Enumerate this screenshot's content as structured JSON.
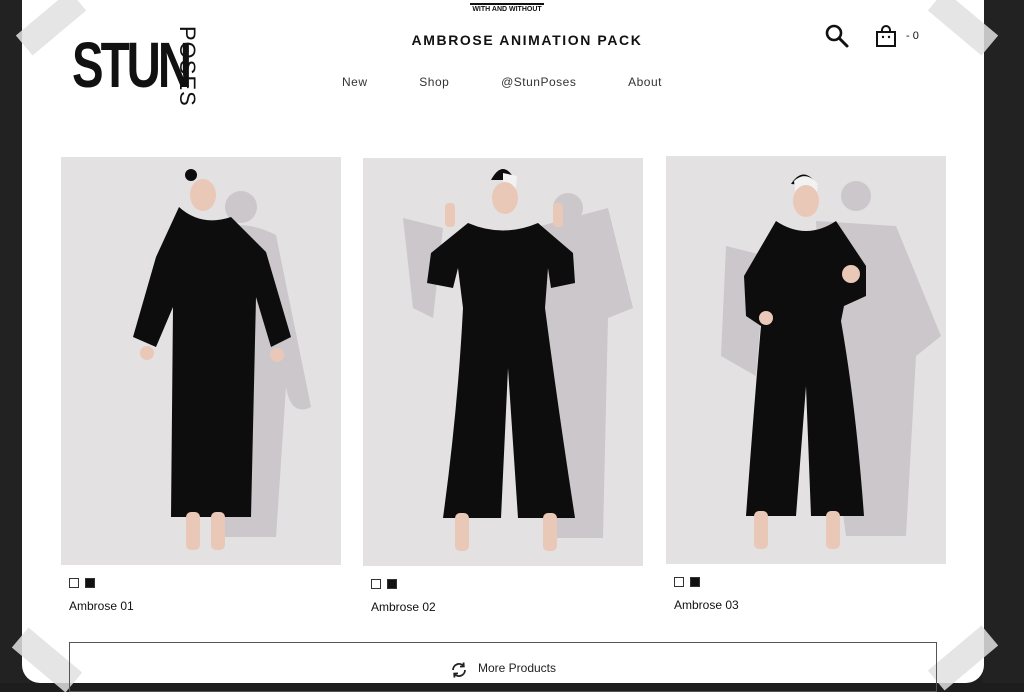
{
  "promo": {
    "line": "WITH AND WITHOUT"
  },
  "logo": {
    "main": "STUN",
    "sub": "POSES"
  },
  "page_title": "AMBROSE ANIMATION PACK",
  "nav": [
    "New",
    "Shop",
    "@StunPoses",
    "About"
  ],
  "cart": {
    "count_label": "- 0"
  },
  "products": [
    {
      "name": "Ambrose 01",
      "pose": "hands-out"
    },
    {
      "name": "Ambrose 02",
      "pose": "hands-up"
    },
    {
      "name": "Ambrose 03",
      "pose": "hand-raised"
    }
  ],
  "more_button": {
    "label": "More Products",
    "icon": "refresh-icon"
  },
  "colors": {
    "accent": "#111111",
    "image_bg": "#e4e1e3",
    "shadow": "#c9c5c9"
  }
}
